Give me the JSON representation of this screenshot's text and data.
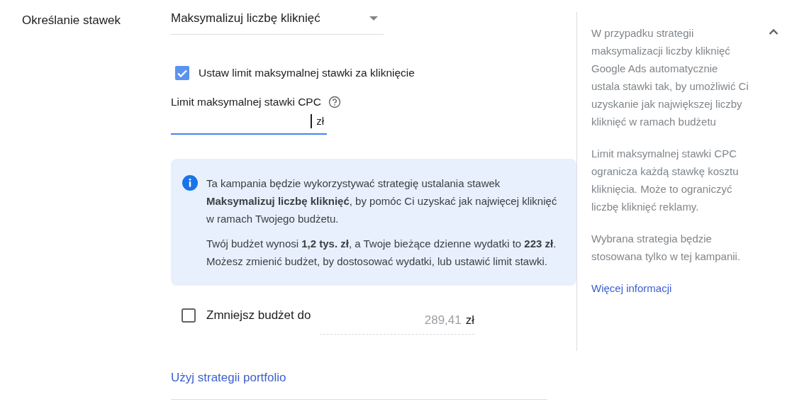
{
  "section_label": "Określanie stawek",
  "strategy_dropdown": {
    "value": "Maksymalizuj liczbę kliknięć"
  },
  "max_bid_checkbox": {
    "label": "Ustaw limit maksymalnej stawki za kliknięcie",
    "checked": true
  },
  "max_cpc_field": {
    "label": "Limit maksymalnej stawki CPC",
    "suffix": "zł",
    "focused": true
  },
  "info_box": {
    "paragraphs": [
      "Ta kampania będzie wykorzystywać strategię ustalania stawek **Maksymalizuj liczbę kliknięć**, by pomóc Ci uzyskać jak najwięcej kliknięć w ramach Twojego budżetu.",
      "Twój budżet wynosi **1,2 tys. zł**, a Twoje bieżące dzienne wydatki to **223 zł**. Możesz zmienić budżet, by dostosować wydatki, lub ustawić limit stawki."
    ]
  },
  "reduce_budget": {
    "label": "Zmniejsz budżet do",
    "checked": false,
    "value": "289,41",
    "suffix": "zł"
  },
  "portfolio_link": "Użyj strategii portfolio",
  "help_panel": {
    "expanded": true,
    "paragraphs": [
      "W przypadku strategii maksymalizacji liczby kliknięć Google Ads automatycznie ustala stawki tak, by umożliwić Ci uzyskanie jak największej liczby kliknięć w ramach budżetu",
      "Limit maksymalnej stawki CPC ogranicza każdą stawkę kosztu kliknięcia. Może to ograniczyć liczbę kliknięć reklamy.",
      "Wybrana strategia będzie stosowana tylko w tej kampanii."
    ],
    "link": "Więcej informacji"
  }
}
